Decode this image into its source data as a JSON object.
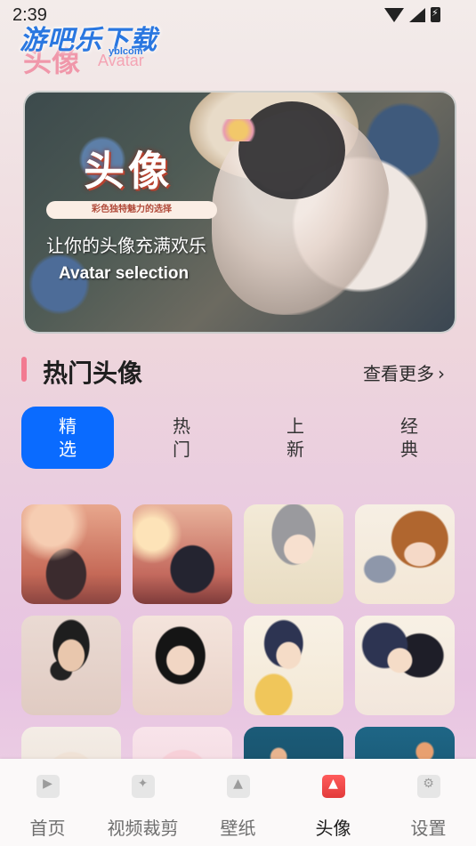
{
  "status": {
    "time": "2:39"
  },
  "watermark": {
    "brand": "游吧乐下载",
    "domain": "yblcom"
  },
  "header": {
    "title": "头像",
    "subtitle": "Avatar"
  },
  "banner": {
    "title": "头像",
    "pill": "彩色独特魅力的选择",
    "slogan": "让你的头像充满欢乐",
    "english": "Avatar selection"
  },
  "section": {
    "title": "热门头像",
    "more": "查看更多",
    "more_icon": "chevron-right-icon"
  },
  "tabs": [
    {
      "label": "精选",
      "active": true
    },
    {
      "label": "热门",
      "active": false
    },
    {
      "label": "上新",
      "active": false
    },
    {
      "label": "经典",
      "active": false
    }
  ],
  "grid": {
    "count": 12
  },
  "nav": [
    {
      "label": "首页",
      "icon": "video-icon",
      "active": false
    },
    {
      "label": "视频裁剪",
      "icon": "magic-wand-icon",
      "active": false
    },
    {
      "label": "壁纸",
      "icon": "image-icon",
      "active": false
    },
    {
      "label": "头像",
      "icon": "avatar-image-icon",
      "active": true
    },
    {
      "label": "设置",
      "icon": "settings-icon",
      "active": false
    }
  ],
  "colors": {
    "accent": "#0a6bff",
    "section_bar": "#f27a91",
    "nav_active_icon": "#e23b3b"
  }
}
